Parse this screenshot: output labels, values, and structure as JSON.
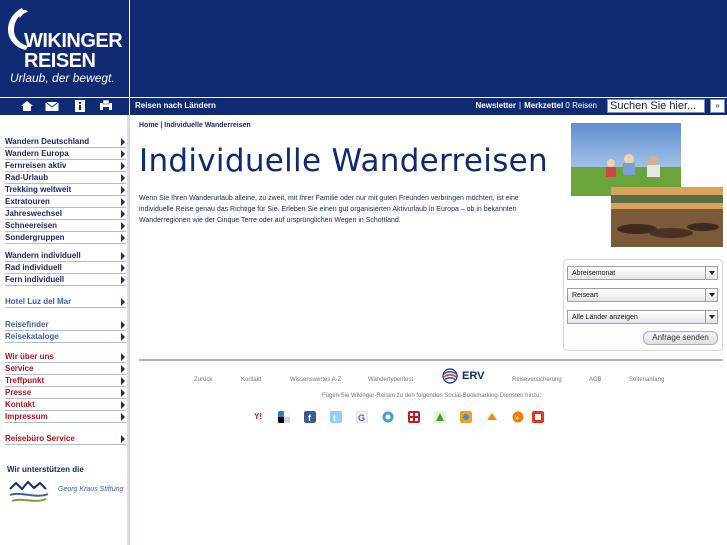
{
  "brand": {
    "name_line1": "WIKINGER",
    "name_line2": "REISEN",
    "slogan": "Urlaub, der bewegt."
  },
  "colors": {
    "navy": "#0f2a73",
    "text_blue": "#1b2a6b",
    "light_blue": "#3d5fae",
    "red": "#b31217"
  },
  "nav": {
    "icons": [
      "home-icon",
      "mail-icon",
      "info-icon",
      "print-icon"
    ],
    "left_link": "Reisen nach Ländern",
    "newsletter": "Newsletter",
    "merkzettel": "Merkzettel",
    "merkzettel_count": "0 Reisen",
    "search_placeholder": "Suchen Sie hier...",
    "search_go": "»"
  },
  "sidebar": {
    "group1": [
      "Wandern Deutschland",
      "Wandern Europa",
      "Fernreisen aktiv",
      "Rad-Urlaub",
      "Trekking weltweit",
      "Extratouren",
      "Jahreswechsel",
      "Schneereisen",
      "Sondergruppen"
    ],
    "group2": [
      "Wandern individuell",
      "Rad individuell",
      "Fern individuell"
    ],
    "group3": [
      "Hotel Luz del Mar"
    ],
    "group4": [
      "Reisefinder",
      "Reisekataloge"
    ],
    "group5": [
      "Wir über uns",
      "Service",
      "Treffpunkt",
      "Presse",
      "Kontakt",
      "Impressum"
    ],
    "group6": [
      "Reisebüro Service"
    ],
    "support_title": "Wir unterstützen die",
    "support_org": "Georg Kraus Stiftung"
  },
  "main": {
    "breadcrumb": "Home | Individuelle Wanderreisen",
    "title": "Individuelle Wanderreisen",
    "intro": "Wenn Sie Ihren Wanderurlaub alleine, zu zweit, mit Ihrer Familie oder nur mit guten Freunden verbringen möchten, ist eine individuelle Reise genau das Richtige für Sie. Erleben Sie einen gut organisierten Aktivurlaub in Europa – ob in bekannten Wanderregionen wie der Cinque Terre oder auf ursprünglichen Wegen in Schottland."
  },
  "inquiry": {
    "month": "Abreisemonat",
    "type": "Reiseart",
    "countries": "Alle Länder anzeigen",
    "send": "Anfrage senden"
  },
  "footer": {
    "links": [
      "Zurück",
      "Kontakt",
      "Wissenswertes A-Z",
      "Wandertypentest",
      "Reiseversicherung",
      "AGB",
      "Seitenanfang"
    ],
    "erv": "ERV",
    "bookmark_text": "Fügen Sie Wikinger-Reisen zu den folgenden Social-Bookmarking-Diensten hinzu:",
    "social_labels": [
      "Y!"
    ]
  }
}
